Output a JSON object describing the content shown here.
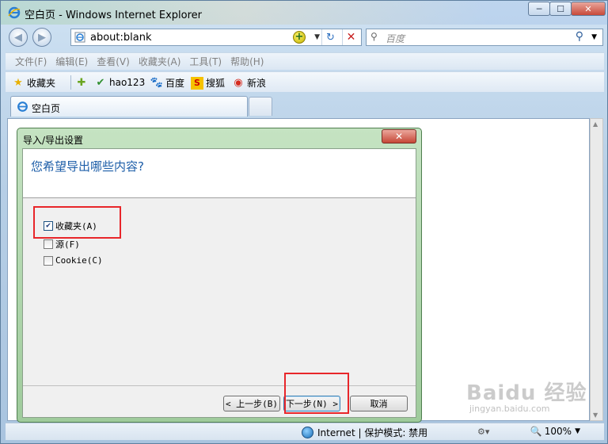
{
  "window": {
    "title": "空白页 - Windows Internet Explorer",
    "min_glyph": "─",
    "max_glyph": "☐",
    "close_glyph": "✕"
  },
  "nav": {
    "back_glyph": "◀",
    "forward_glyph": "▶"
  },
  "address": {
    "url": "about:blank",
    "add_glyph": "+",
    "dropdown_glyph": "▼",
    "refresh_glyph": "↻",
    "stop_glyph": "✕"
  },
  "search": {
    "placeholder": "百度",
    "go_glyph": "⚲",
    "dropdown_glyph": "▼"
  },
  "menu": [
    "文件(F)",
    "编辑(E)",
    "查看(V)",
    "收藏夹(A)",
    "工具(T)",
    "帮助(H)"
  ],
  "favorites": {
    "label": "收藏夹",
    "items": [
      "hao123",
      "百度",
      "搜狐",
      "新浪"
    ]
  },
  "tab": {
    "label": "空白页"
  },
  "dialog": {
    "title": "导入/导出设置",
    "question": "您希望导出哪些内容?",
    "close_glyph": "✕",
    "options": [
      {
        "label": "收藏夹(A)",
        "checked": true
      },
      {
        "label": "源(F)",
        "checked": false
      },
      {
        "label": "Cookie(C)",
        "checked": false
      }
    ],
    "buttons": {
      "back": "< 上一步(B)",
      "next": "下一步(N) >",
      "cancel": "取消"
    }
  },
  "status": {
    "zone": "Internet | 保护模式: 禁用",
    "zoom": "100%"
  },
  "watermark": {
    "logo": "Baidu 经验",
    "url": "jingyan.baidu.com"
  },
  "colors": {
    "highlight": "#e8262a",
    "dialog_question": "#1d5ea8",
    "dialog_frame": "#9fcb9c"
  }
}
